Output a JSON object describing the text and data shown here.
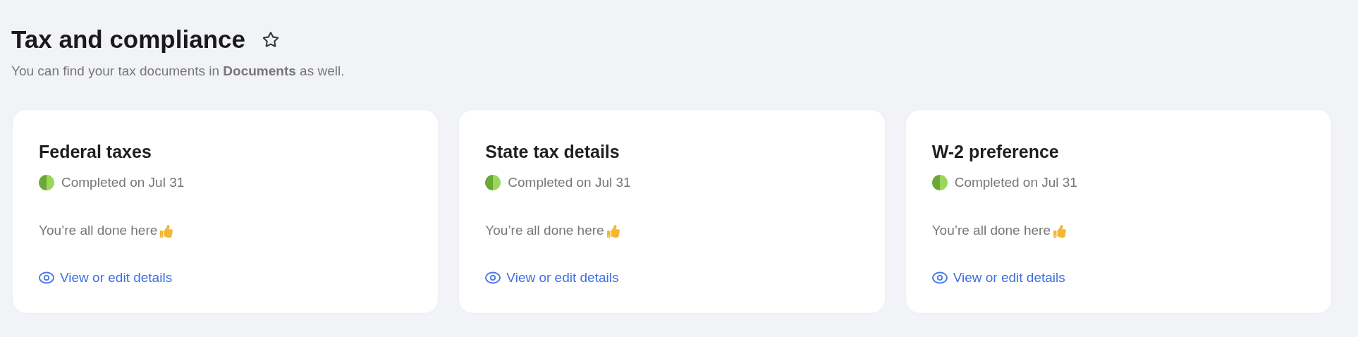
{
  "header": {
    "title": "Tax and compliance",
    "favorite": false,
    "subtitle": "You can find your tax documents in **Documents** as well."
  },
  "cards": [
    {
      "title": "Federal taxes",
      "status": "Completed on Jul 31",
      "message": "You’re all done here",
      "link": "View or edit details"
    },
    {
      "title": "State tax details",
      "status": "Completed on Jul 31",
      "message": "You’re all done here",
      "link": "View or edit details"
    },
    {
      "title": "W-2 preference",
      "status": "Completed on Jul 31",
      "message": "You’re all done here",
      "link": "View or edit details"
    }
  ]
}
